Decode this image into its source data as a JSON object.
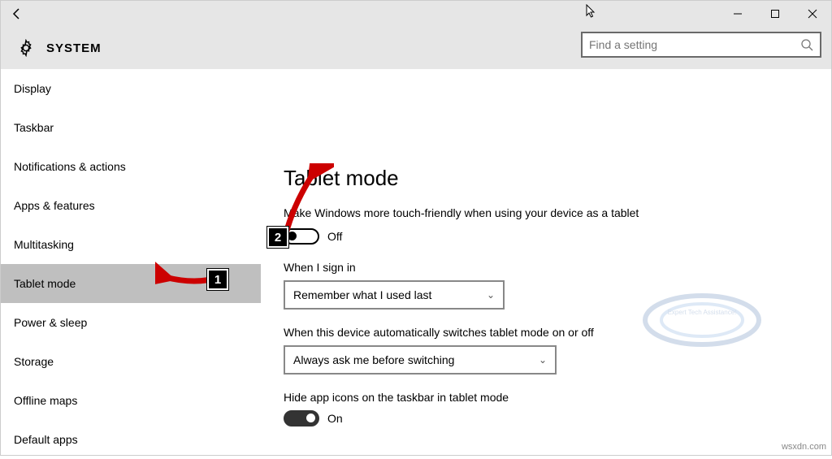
{
  "window": {
    "title": "SYSTEM"
  },
  "search": {
    "placeholder": "Find a setting"
  },
  "sidebar": {
    "items": [
      {
        "label": "Display"
      },
      {
        "label": "Taskbar"
      },
      {
        "label": "Notifications & actions"
      },
      {
        "label": "Apps & features"
      },
      {
        "label": "Multitasking"
      },
      {
        "label": "Tablet mode",
        "selected": true
      },
      {
        "label": "Power & sleep"
      },
      {
        "label": "Storage"
      },
      {
        "label": "Offline maps"
      },
      {
        "label": "Default apps"
      }
    ]
  },
  "content": {
    "heading": "Tablet mode",
    "desc": "Make Windows more touch-friendly when using your device as a tablet",
    "toggle1_state": "Off",
    "signin_label": "When I sign in",
    "signin_value": "Remember what I used last",
    "auto_label": "When this device automatically switches tablet mode on or off",
    "auto_value": "Always ask me before switching",
    "hide_label": "Hide app icons on the taskbar in tablet mode",
    "toggle2_state": "On"
  },
  "annotations": {
    "badge1": "1",
    "badge2": "2"
  },
  "watermark": "wsxdn.com"
}
